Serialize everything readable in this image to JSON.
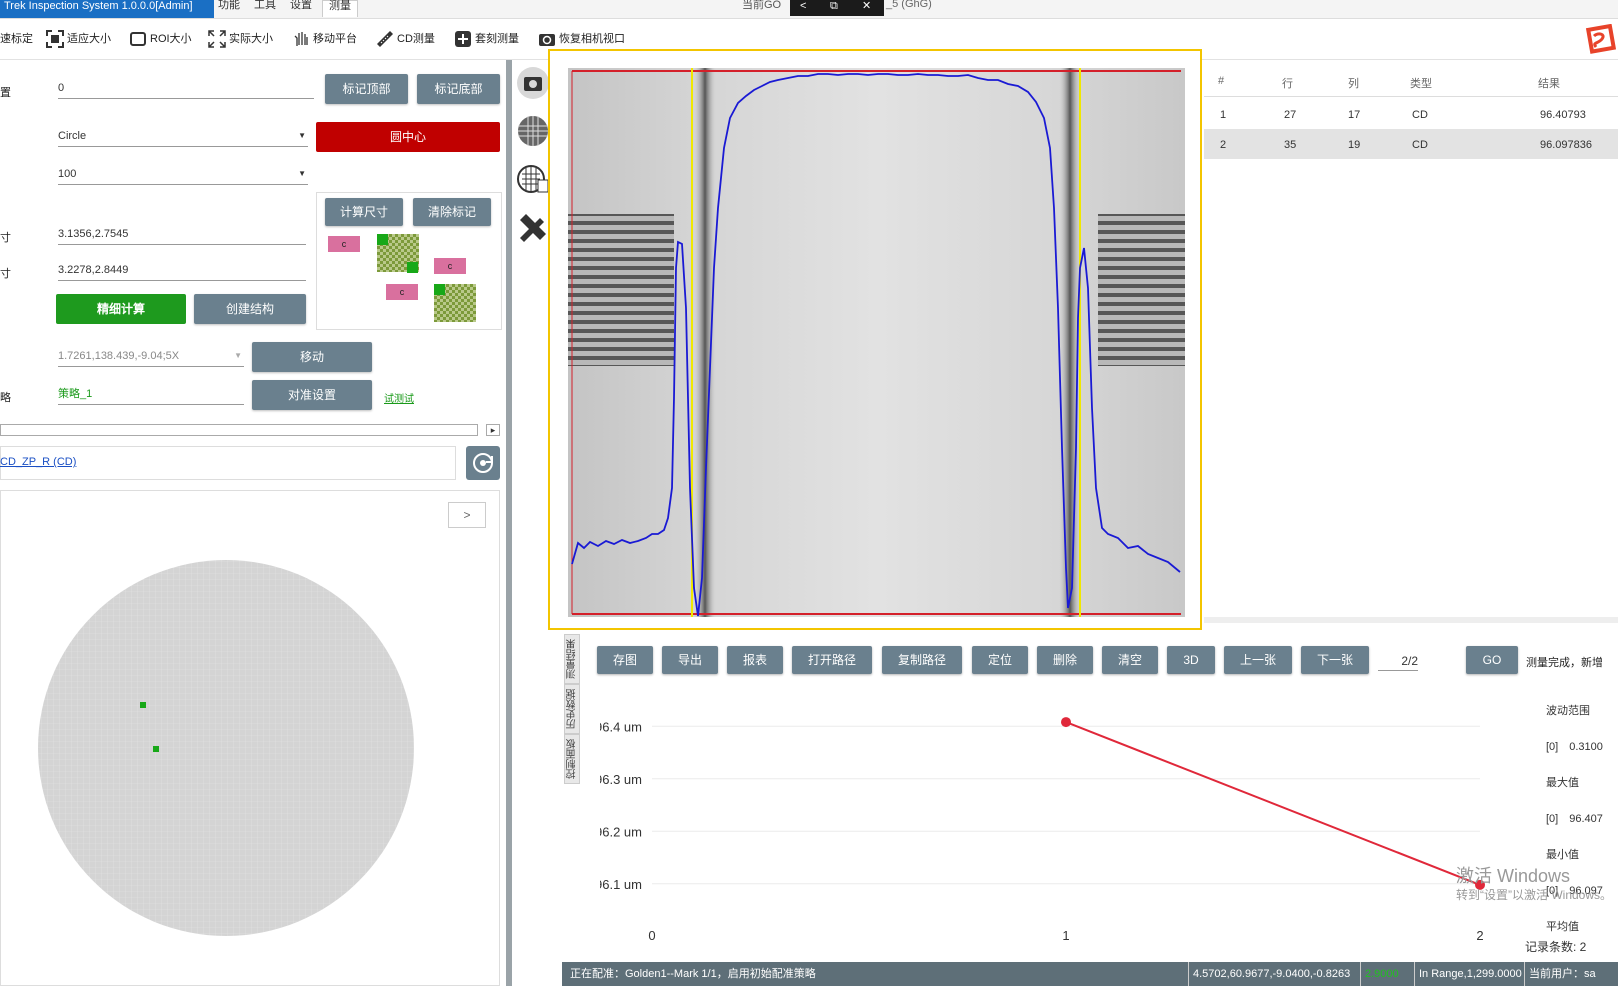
{
  "app": {
    "title": "Trek Inspection System 1.0.0.0[Admin]"
  },
  "menu": [
    "功能",
    "工具",
    "设置",
    "测量"
  ],
  "window_controls": [
    "<",
    "⧉",
    "✕"
  ],
  "window_title_fragment": "当前GO",
  "window_title_suffix": "_5 (GhG)",
  "toolbar": {
    "items": [
      {
        "label": "速标定",
        "icon": "calibrate-icon"
      },
      {
        "label": "适应大小",
        "icon": "fit-size-icon"
      },
      {
        "label": "ROI大小",
        "icon": "roi-size-icon"
      },
      {
        "label": "实际大小",
        "icon": "actual-size-icon"
      },
      {
        "label": "移动平台",
        "icon": "hand-move-icon"
      },
      {
        "label": "CD测量",
        "icon": "ruler-icon"
      },
      {
        "label": "套刻测量",
        "icon": "plus-box-icon"
      },
      {
        "label": "恢复相机视口",
        "icon": "camera-refresh-icon"
      }
    ]
  },
  "left": {
    "position": {
      "label": "置",
      "value": "0"
    },
    "shape": {
      "value": "Circle"
    },
    "count": {
      "value": "100"
    },
    "size1": {
      "label": "寸",
      "value": "3.1356,2.7545"
    },
    "size2": {
      "label": "寸",
      "value": "3.2278,2.8449"
    },
    "coords": {
      "value": "1.7261,138.439,-9.04;5X"
    },
    "strategy": {
      "label": "略",
      "value": "策略_1"
    },
    "test_link": "试测试",
    "buttons": {
      "mark_top": "标记顶部",
      "mark_bottom": "标记底部",
      "circle_center": "圆中心",
      "calc_size": "计算尺寸",
      "clear_mark": "清除标记",
      "fine_calc": "精细计算",
      "create_struct": "创建结构",
      "move": "移动",
      "align_settings": "对准设置"
    },
    "diagram_tags": [
      "c",
      "c",
      "c"
    ],
    "recipe_link": "CD_ZP_R (CD)",
    "wafer_next": ">",
    "scroll_arrow": "▸"
  },
  "table": {
    "columns": [
      "#",
      "行",
      "列",
      "类型",
      "结果"
    ],
    "rows": [
      [
        "1",
        "27",
        "17",
        "CD",
        "96.40793"
      ],
      [
        "2",
        "35",
        "19",
        "CD",
        "96.097836"
      ]
    ]
  },
  "bottom": {
    "vertical_tabs": [
      "测量结果",
      "历史数据",
      "控制面板"
    ],
    "buttons": [
      "存图",
      "导出",
      "报表",
      "打开路径",
      "复制路径",
      "定位",
      "删除",
      "清空",
      "3D",
      "上一张",
      "下一张"
    ],
    "page": "2/2",
    "go": "GO",
    "status_msg": "测量完成，新增",
    "chart": {
      "y_ticks": [
        "96.4 um",
        "96.3 um",
        "96.2 um",
        "96.1 um"
      ],
      "x_ticks": [
        "0",
        "1",
        "2"
      ]
    },
    "side": {
      "range_label": "波动范围",
      "range_value": "[0]　0.3100",
      "max_label": "最大值",
      "max_value": "[0]　96.407",
      "min_label": "最小值",
      "min_value": "[0]　96.097",
      "avg_label": "平均值",
      "record_count": "记录条数: 2"
    }
  },
  "chart_data": {
    "type": "line",
    "x": [
      1,
      2
    ],
    "values": [
      96.40793,
      96.097836
    ],
    "xlim": [
      0,
      2
    ],
    "ylim": [
      96.05,
      96.45
    ],
    "y_ticks": [
      96.4,
      96.3,
      96.2,
      96.1
    ],
    "grid": true,
    "color": "#e0283a"
  },
  "status": {
    "left": "正在配准：Golden1--Mark 1/1，启用初始配准策略",
    "coords": "4.5702,60.9677,-9.0400,-0.8263",
    "green_value": "2.9000",
    "range": "In Range,1,299.0000",
    "user": "当前用户：sa"
  },
  "watermark": {
    "line1": "激活 Windows",
    "line2": "转到“设置”以激活 Windows。"
  },
  "colors": {
    "accent_blue": "#1a6fc4",
    "button_slate": "#6a808e",
    "viewer_border": "#f3c500",
    "red": "#c00000",
    "green": "#1e9a1e"
  }
}
